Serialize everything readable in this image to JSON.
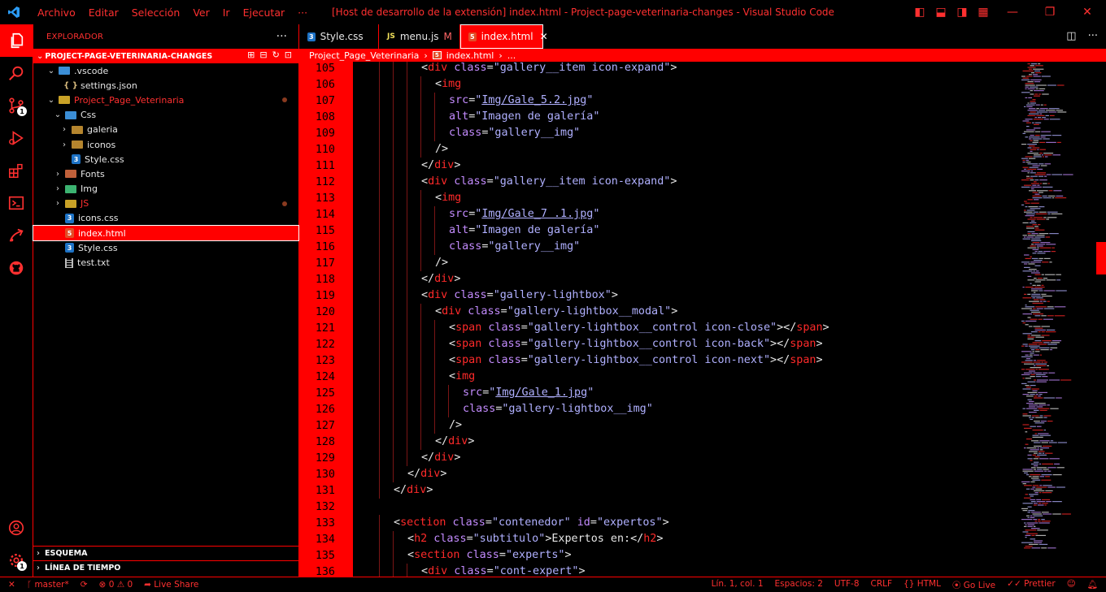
{
  "titlebar": {
    "menu": [
      "Archivo",
      "Editar",
      "Selección",
      "Ver",
      "Ir",
      "Ejecutar",
      "···"
    ],
    "title": "[Host de desarrollo de la extensión] index.html - Project-page-veterinaria-changes - Visual Studio Code"
  },
  "activity": {
    "source_control_badge": "1",
    "accounts_badge": "1"
  },
  "sidebar": {
    "header": "EXPLORADOR",
    "more": "···",
    "project": "PROJECT-PAGE-VETERINARIA-CHANGES",
    "tree": [
      {
        "label": ".vscode",
        "depth": 1,
        "kind": "folder-blue",
        "open": true
      },
      {
        "label": "settings.json",
        "depth": 2,
        "kind": "json"
      },
      {
        "label": "Project_Page_Veterinaria",
        "depth": 1,
        "kind": "folder-yel",
        "open": true,
        "red": true,
        "modified": true
      },
      {
        "label": "Css",
        "depth": 2,
        "kind": "folder-blue",
        "open": true
      },
      {
        "label": "galeria",
        "depth": 3,
        "kind": "folder",
        "open": false
      },
      {
        "label": "iconos",
        "depth": 3,
        "kind": "folder",
        "open": false
      },
      {
        "label": "Style.css",
        "depth": 3,
        "kind": "css"
      },
      {
        "label": "Fonts",
        "depth": 2,
        "kind": "folder-font",
        "open": false
      },
      {
        "label": "Img",
        "depth": 2,
        "kind": "folder-green",
        "open": false
      },
      {
        "label": "JS",
        "depth": 2,
        "kind": "folder-yel",
        "open": false,
        "red": true,
        "modified": true
      },
      {
        "label": "icons.css",
        "depth": 2,
        "kind": "css"
      },
      {
        "label": "index.html",
        "depth": 2,
        "kind": "html",
        "selected": true
      },
      {
        "label": "Style.css",
        "depth": 2,
        "kind": "css"
      },
      {
        "label": "test.txt",
        "depth": 2,
        "kind": "txt"
      }
    ],
    "outline": "ESQUEMA",
    "timeline": "LÍNEA DE TIEMPO"
  },
  "tabs": [
    {
      "label": "Style.css",
      "icon": "css",
      "active": false
    },
    {
      "label": "menu.js",
      "icon": "js",
      "modified": "M",
      "active": false
    },
    {
      "label": "index.html",
      "icon": "html",
      "active": true
    }
  ],
  "breadcrumb": {
    "folder": "Project_Page_Veterinaria",
    "file": "index.html",
    "more": "..."
  },
  "editor": {
    "lines": [
      {
        "n": "105",
        "indent": 4,
        "t": [
          [
            "tg",
            "<"
          ],
          [
            "tn",
            "div"
          ],
          [
            "at",
            " class"
          ],
          [
            "tg",
            "="
          ],
          [
            "st",
            "\"gallery__item icon-expand\""
          ],
          [
            "tg",
            ">"
          ]
        ]
      },
      {
        "n": "106",
        "indent": 5,
        "t": [
          [
            "tg",
            "<"
          ],
          [
            "tn",
            "img"
          ]
        ]
      },
      {
        "n": "107",
        "indent": 6,
        "t": [
          [
            "at",
            "src"
          ],
          [
            "tg",
            "="
          ],
          [
            "st",
            "\""
          ],
          [
            "lk",
            "Img/Gale_5.2.jpg"
          ],
          [
            "st",
            "\""
          ]
        ]
      },
      {
        "n": "108",
        "indent": 6,
        "t": [
          [
            "at",
            "alt"
          ],
          [
            "tg",
            "="
          ],
          [
            "st",
            "\"Imagen de galería\""
          ]
        ]
      },
      {
        "n": "109",
        "indent": 6,
        "t": [
          [
            "at",
            "class"
          ],
          [
            "tg",
            "="
          ],
          [
            "st",
            "\"gallery__img\""
          ]
        ]
      },
      {
        "n": "110",
        "indent": 5,
        "t": [
          [
            "tg",
            "/>"
          ]
        ]
      },
      {
        "n": "111",
        "indent": 4,
        "t": [
          [
            "tg",
            "</"
          ],
          [
            "tn",
            "div"
          ],
          [
            "tg",
            ">"
          ]
        ]
      },
      {
        "n": "112",
        "indent": 4,
        "t": [
          [
            "tg",
            "<"
          ],
          [
            "tn",
            "div"
          ],
          [
            "at",
            " class"
          ],
          [
            "tg",
            "="
          ],
          [
            "st",
            "\"gallery__item icon-expand\""
          ],
          [
            "tg",
            ">"
          ]
        ]
      },
      {
        "n": "113",
        "indent": 5,
        "t": [
          [
            "tg",
            "<"
          ],
          [
            "tn",
            "img"
          ]
        ]
      },
      {
        "n": "114",
        "indent": 6,
        "t": [
          [
            "at",
            "src"
          ],
          [
            "tg",
            "="
          ],
          [
            "st",
            "\""
          ],
          [
            "lk",
            "Img/Gale_7 .1.jpg"
          ],
          [
            "st",
            "\""
          ]
        ]
      },
      {
        "n": "115",
        "indent": 6,
        "t": [
          [
            "at",
            "alt"
          ],
          [
            "tg",
            "="
          ],
          [
            "st",
            "\"Imagen de galería\""
          ]
        ]
      },
      {
        "n": "116",
        "indent": 6,
        "t": [
          [
            "at",
            "class"
          ],
          [
            "tg",
            "="
          ],
          [
            "st",
            "\"gallery__img\""
          ]
        ]
      },
      {
        "n": "117",
        "indent": 5,
        "t": [
          [
            "tg",
            "/>"
          ]
        ]
      },
      {
        "n": "118",
        "indent": 4,
        "t": [
          [
            "tg",
            "</"
          ],
          [
            "tn",
            "div"
          ],
          [
            "tg",
            ">"
          ]
        ]
      },
      {
        "n": "119",
        "indent": 4,
        "t": [
          [
            "tg",
            "<"
          ],
          [
            "tn",
            "div"
          ],
          [
            "at",
            " class"
          ],
          [
            "tg",
            "="
          ],
          [
            "st",
            "\"gallery-lightbox\""
          ],
          [
            "tg",
            ">"
          ]
        ]
      },
      {
        "n": "120",
        "indent": 5,
        "t": [
          [
            "tg",
            "<"
          ],
          [
            "tn",
            "div"
          ],
          [
            "at",
            " class"
          ],
          [
            "tg",
            "="
          ],
          [
            "st",
            "\"gallery-lightbox__modal\""
          ],
          [
            "tg",
            ">"
          ]
        ]
      },
      {
        "n": "121",
        "indent": 6,
        "t": [
          [
            "tg",
            "<"
          ],
          [
            "tn",
            "span"
          ],
          [
            "at",
            " class"
          ],
          [
            "tg",
            "="
          ],
          [
            "st",
            "\"gallery-lightbox__control icon-close\""
          ],
          [
            "tg",
            "></"
          ],
          [
            "tn",
            "span"
          ],
          [
            "tg",
            ">"
          ]
        ]
      },
      {
        "n": "122",
        "indent": 6,
        "t": [
          [
            "tg",
            "<"
          ],
          [
            "tn",
            "span"
          ],
          [
            "at",
            " class"
          ],
          [
            "tg",
            "="
          ],
          [
            "st",
            "\"gallery-lightbox__control icon-back\""
          ],
          [
            "tg",
            "></"
          ],
          [
            "tn",
            "span"
          ],
          [
            "tg",
            ">"
          ]
        ]
      },
      {
        "n": "123",
        "indent": 6,
        "t": [
          [
            "tg",
            "<"
          ],
          [
            "tn",
            "span"
          ],
          [
            "at",
            " class"
          ],
          [
            "tg",
            "="
          ],
          [
            "st",
            "\"gallery-lightbox__control icon-next\""
          ],
          [
            "tg",
            "></"
          ],
          [
            "tn",
            "span"
          ],
          [
            "tg",
            ">"
          ]
        ]
      },
      {
        "n": "124",
        "indent": 6,
        "t": [
          [
            "tg",
            "<"
          ],
          [
            "tn",
            "img"
          ]
        ]
      },
      {
        "n": "125",
        "indent": 7,
        "t": [
          [
            "at",
            "src"
          ],
          [
            "tg",
            "="
          ],
          [
            "st",
            "\""
          ],
          [
            "lk",
            "Img/Gale_1.jpg"
          ],
          [
            "st",
            "\""
          ]
        ]
      },
      {
        "n": "126",
        "indent": 7,
        "t": [
          [
            "at",
            "class"
          ],
          [
            "tg",
            "="
          ],
          [
            "st",
            "\"gallery-lightbox__img\""
          ]
        ]
      },
      {
        "n": "127",
        "indent": 6,
        "t": [
          [
            "tg",
            "/>"
          ]
        ]
      },
      {
        "n": "128",
        "indent": 5,
        "t": [
          [
            "tg",
            "</"
          ],
          [
            "tn",
            "div"
          ],
          [
            "tg",
            ">"
          ]
        ]
      },
      {
        "n": "129",
        "indent": 4,
        "t": [
          [
            "tg",
            "</"
          ],
          [
            "tn",
            "div"
          ],
          [
            "tg",
            ">"
          ]
        ]
      },
      {
        "n": "130",
        "indent": 3,
        "t": [
          [
            "tg",
            "</"
          ],
          [
            "tn",
            "div"
          ],
          [
            "tg",
            ">"
          ]
        ]
      },
      {
        "n": "131",
        "indent": 2,
        "t": [
          [
            "tg",
            "</"
          ],
          [
            "tn",
            "div"
          ],
          [
            "tg",
            ">"
          ]
        ]
      },
      {
        "n": "132",
        "indent": 0,
        "t": []
      },
      {
        "n": "133",
        "indent": 2,
        "t": [
          [
            "tg",
            "<"
          ],
          [
            "tn",
            "section"
          ],
          [
            "at",
            " class"
          ],
          [
            "tg",
            "="
          ],
          [
            "st",
            "\"contenedor\""
          ],
          [
            "at",
            " id"
          ],
          [
            "tg",
            "="
          ],
          [
            "st",
            "\"expertos\""
          ],
          [
            "tg",
            ">"
          ]
        ]
      },
      {
        "n": "134",
        "indent": 3,
        "t": [
          [
            "tg",
            "<"
          ],
          [
            "tn",
            "h2"
          ],
          [
            "at",
            " class"
          ],
          [
            "tg",
            "="
          ],
          [
            "st",
            "\"subtitulo\""
          ],
          [
            "tg",
            ">"
          ],
          [
            "tx",
            "Expertos en:"
          ],
          [
            "tg",
            "</"
          ],
          [
            "tn",
            "h2"
          ],
          [
            "tg",
            ">"
          ]
        ]
      },
      {
        "n": "135",
        "indent": 3,
        "t": [
          [
            "tg",
            "<"
          ],
          [
            "tn",
            "section"
          ],
          [
            "at",
            " class"
          ],
          [
            "tg",
            "="
          ],
          [
            "st",
            "\"experts\""
          ],
          [
            "tg",
            ">"
          ]
        ]
      },
      {
        "n": "136",
        "indent": 4,
        "t": [
          [
            "tg",
            "<"
          ],
          [
            "tn",
            "div"
          ],
          [
            "at",
            " class"
          ],
          [
            "tg",
            "="
          ],
          [
            "st",
            "\"cont-expert\""
          ],
          [
            "tg",
            ">"
          ]
        ]
      }
    ]
  },
  "statusbar": {
    "branch": "master*",
    "sync": "⟳",
    "errors": "0",
    "warnings": "0",
    "live_share": "Live Share",
    "position": "Lín. 1, col. 1",
    "spaces": "Espacios: 2",
    "encoding": "UTF-8",
    "eol": "CRLF",
    "language": "HTML",
    "go_live": "Go Live",
    "prettier": "Prettier"
  },
  "colors": {
    "accent": "#ff0000",
    "text_red": "#ff3030",
    "tag_name": "#ff2a2a",
    "attr": "#c48cff",
    "string": "#b0b0ff"
  }
}
